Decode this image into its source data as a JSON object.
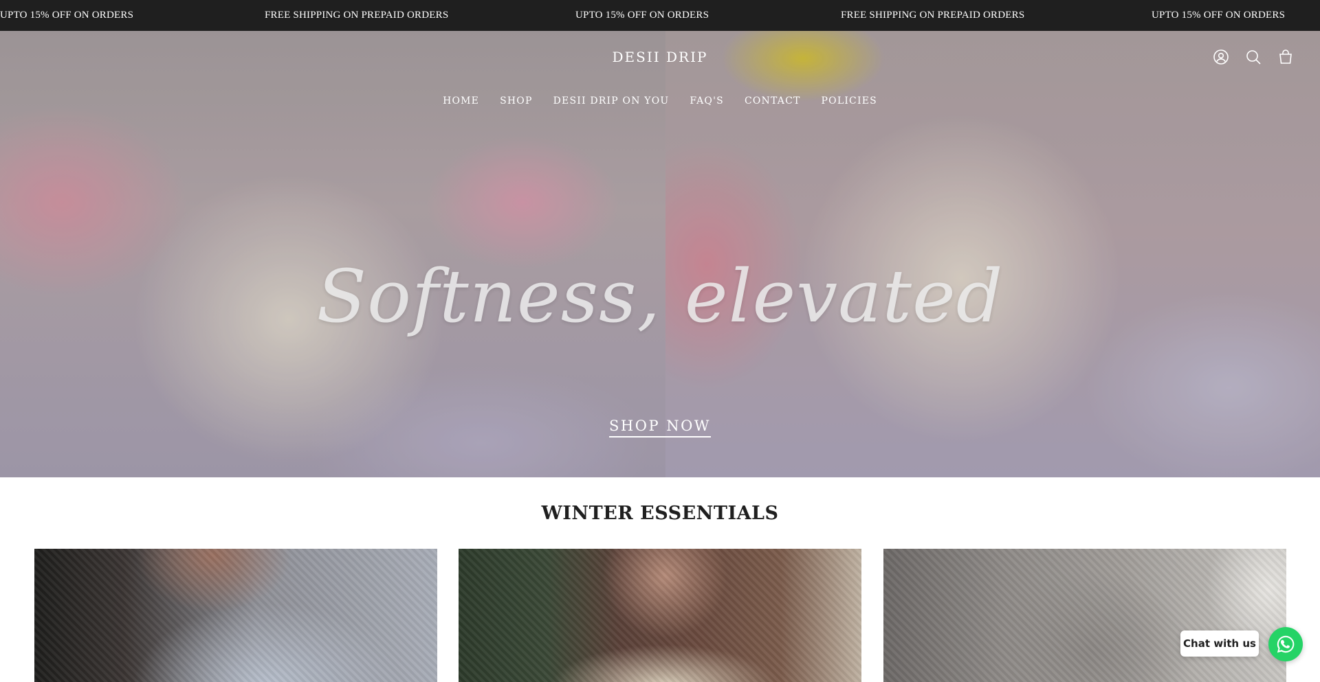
{
  "announcement": {
    "items": [
      "UPTO 15% OFF ON ORDERS",
      "FREE SHIPPING ON PREPAID ORDERS",
      "UPTO 15% OFF ON ORDERS",
      "FREE SHIPPING ON PREPAID ORDERS",
      "UPTO 15% OFF ON ORDERS"
    ]
  },
  "header": {
    "logo": "DESII DRIP",
    "icons": [
      "account-icon",
      "search-icon",
      "cart-icon"
    ]
  },
  "nav": {
    "items": [
      "HOME",
      "SHOP",
      "DESII DRIP ON YOU",
      "FAQ'S",
      "CONTACT",
      "POLICIES"
    ]
  },
  "hero": {
    "headline": "Softness, elevated",
    "cta": "SHOP NOW"
  },
  "section": {
    "title": "WINTER ESSENTIALS"
  },
  "chat": {
    "label": "Chat with us",
    "icon": "whatsapp-icon",
    "color": "#25d366"
  },
  "colors": {
    "announcement_bg": "#1f1f1f",
    "text_light": "#ffffff",
    "text_dark": "#1f1f1f"
  }
}
